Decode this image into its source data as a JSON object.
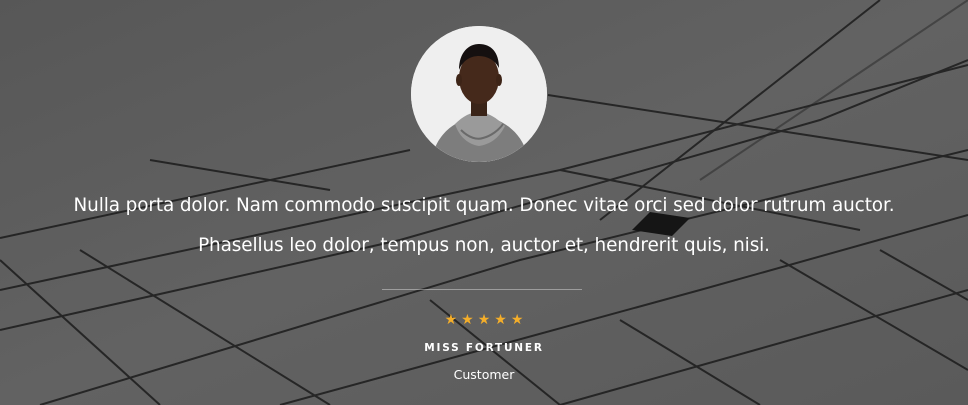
{
  "testimonial": {
    "quote_line_1": "Nulla porta dolor. Nam commodo suscipit quam. Donec vitae orci sed dolor rutrum auctor.",
    "quote_line_2": "Phasellus leo dolor, tempus non, auctor et, hendrerit quis, nisi.",
    "rating": {
      "value": 5,
      "max": 5,
      "icon": "star-icon",
      "color": "#f4ae2a"
    },
    "stars": [
      "★",
      "★",
      "★",
      "★",
      "★"
    ],
    "author_name": "MISS FORTUNER",
    "author_role": "Customer",
    "avatar_icon": "avatar-portrait"
  },
  "theme": {
    "background": "#5e5e5e",
    "text": "#ffffff",
    "accent": "#f4ae2a"
  }
}
